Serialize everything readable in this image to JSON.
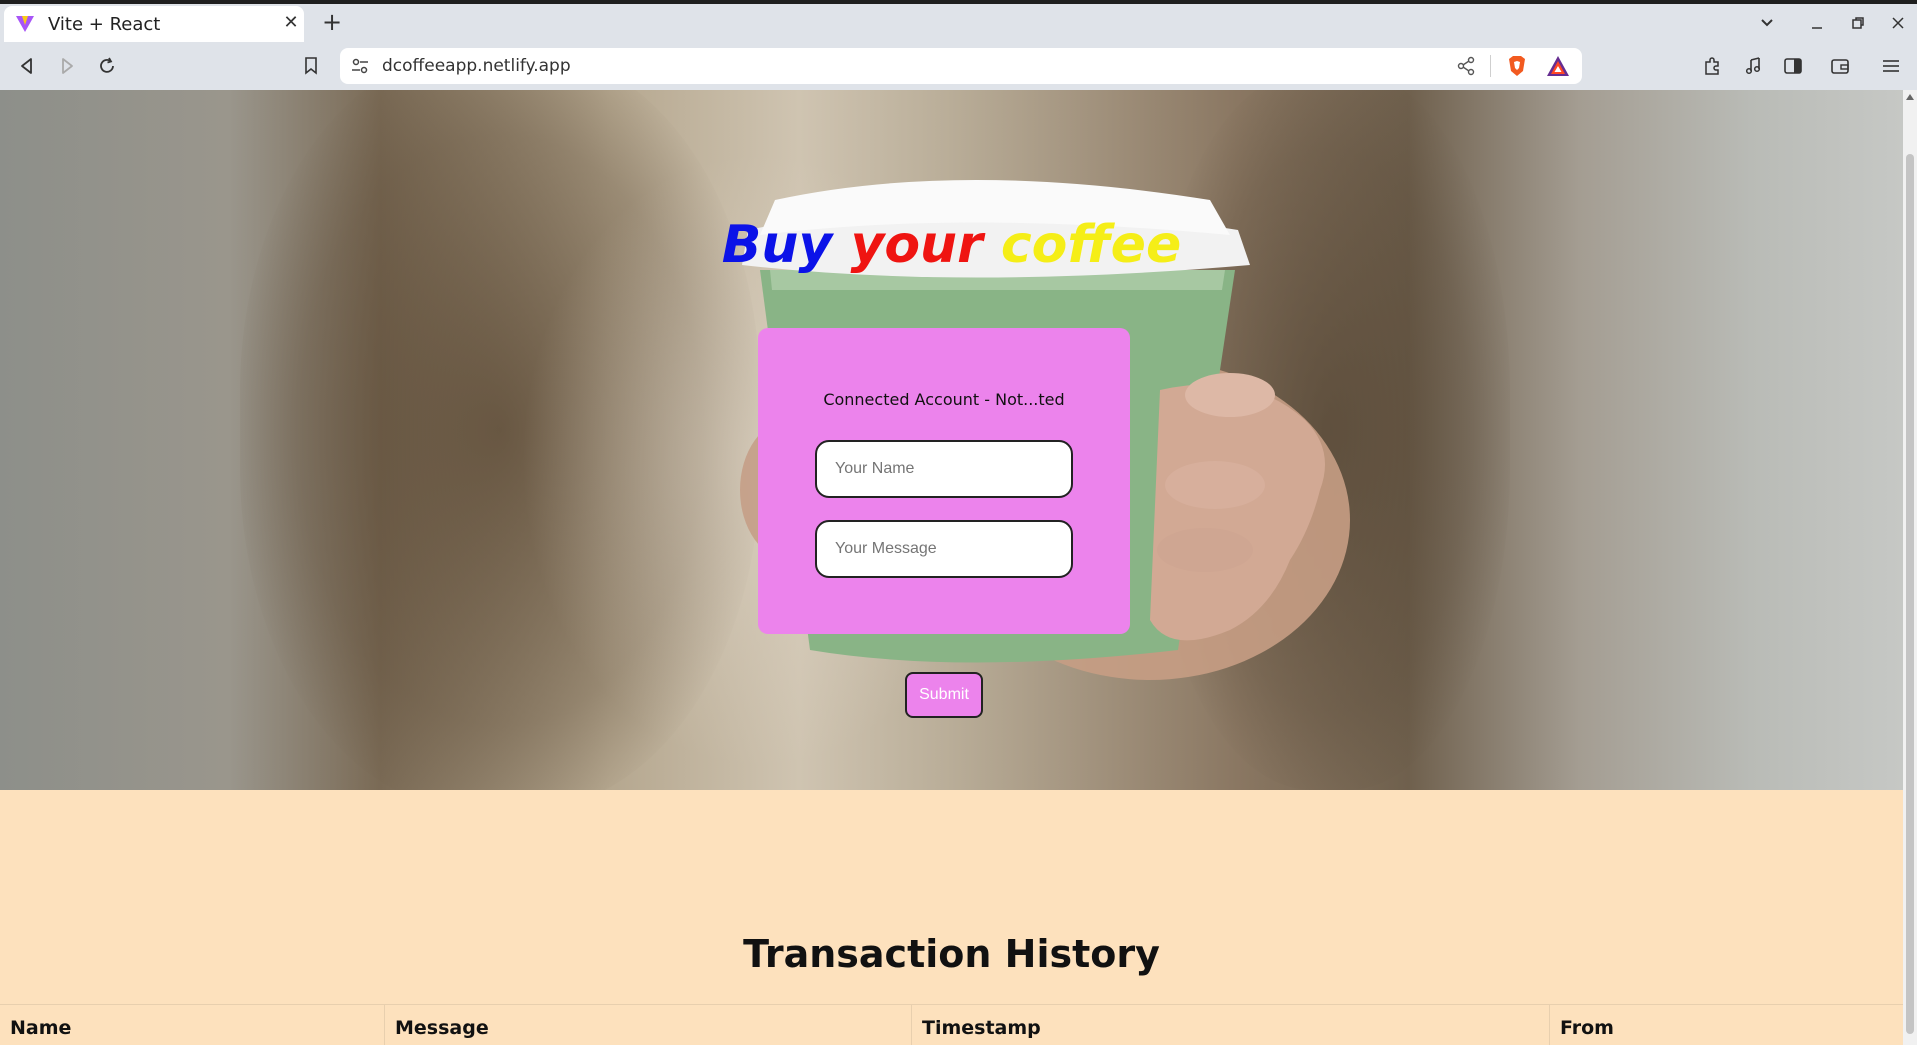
{
  "browser": {
    "tab_title": "Vite + React",
    "url": "dcoffeeapp.netlify.app"
  },
  "hero": {
    "title_words": [
      "Buy",
      "your",
      "coffee"
    ],
    "title_colors": [
      "#0b12e8",
      "#ef1411",
      "#f5ee17"
    ],
    "account_label": "Connected Account - Not...ted",
    "name_placeholder": "Your Name",
    "message_placeholder": "Your Message",
    "submit_label": "Submit"
  },
  "history": {
    "title": "Transaction History",
    "columns": [
      "Name",
      "Message",
      "Timestamp",
      "From"
    ]
  },
  "colors": {
    "card": "#ec83ec",
    "lower_bg": "#fde1bd"
  }
}
